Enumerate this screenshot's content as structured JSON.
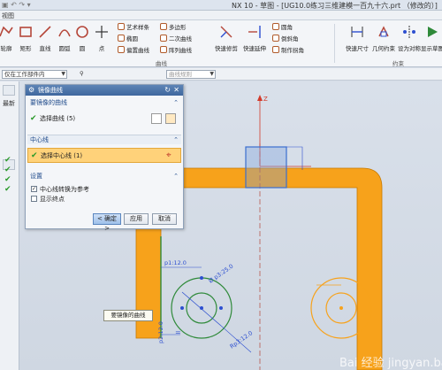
{
  "app": {
    "title": "NX 10 - 草图 - [UG10.0练习三维建模一百九十六.prt （修改的）]",
    "menu": "视图"
  },
  "ribbon": {
    "big_buttons": [
      "轮廓",
      "矩形",
      "直线",
      "圆弧",
      "圆",
      "点"
    ],
    "curve_items": [
      "艺术样条",
      "多边形",
      "椭圆",
      "二次曲线",
      "偏置曲线",
      "阵列曲线"
    ],
    "trim_buttons": [
      "快速修剪",
      "快速延伸"
    ],
    "corner_items": [
      "圆角",
      "倒斜角",
      "制作拐角"
    ],
    "constraint_buttons": [
      "快速尺寸",
      "几何约束",
      "设为对称",
      "显示草图"
    ],
    "group_curve": "曲线",
    "group_constraint": "约束"
  },
  "filterbar": {
    "scope": "仅在工作部件内",
    "type_filter": "曲线规则"
  },
  "leftstrip": {
    "tab_label": "最新"
  },
  "dialog": {
    "title": "镜像曲线",
    "section1": "要镜像的曲线",
    "select_curves": "选择曲线 (5)",
    "section2": "中心线",
    "select_centerline": "选择中心线 (1)",
    "section3": "设置",
    "opt_convert_ref": "中心线转换为参考",
    "opt_show_ends": "显示终点",
    "opt_convert_ref_checked": true,
    "opt_show_ends_checked": false,
    "btn_ok": "< 确定 >",
    "btn_apply": "应用",
    "btn_cancel": "取消"
  },
  "canvas": {
    "tooltip": "要镜像的曲线",
    "dim_p1": "p1:12.0",
    "dim_p2": "p2:12.0",
    "dim_diameter": "Ø p3:25.0",
    "dim_radius": "Rp3:12.0",
    "axis_z": "Z",
    "colors": {
      "orange": "#f7a21b",
      "dim_blue": "#2d4fd0",
      "green": "#2f8a3a",
      "red": "#d23a2a"
    }
  },
  "watermark": "Bai 经验 jingyan.baidu.com"
}
